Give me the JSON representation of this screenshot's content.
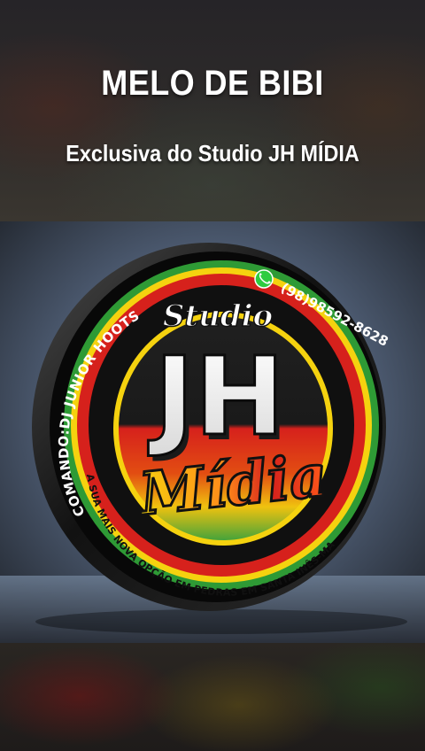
{
  "post": {
    "title": "MELO DE BIBI",
    "subtitle": "Exclusiva do Studio JH MÍDIA"
  },
  "logo": {
    "top_arc_text": "COMANDO:DJ JUNIOR HOOTS",
    "phone_text": "(98)98592-8628",
    "bottom_arc_text": "A SUA MAIS NOVA OPÇÃO EM PEDRAS EM SANTA INÊS-MA",
    "studio_word": "Studio",
    "initials": "JH",
    "media_word": "Mídia",
    "whatsapp_icon": "whatsapp-icon"
  },
  "colors": {
    "text": "#ffffff",
    "reggae_red": "#d6211c",
    "reggae_yellow": "#f5d20f",
    "reggae_green": "#2e9a35",
    "rim_dark": "#151515"
  }
}
